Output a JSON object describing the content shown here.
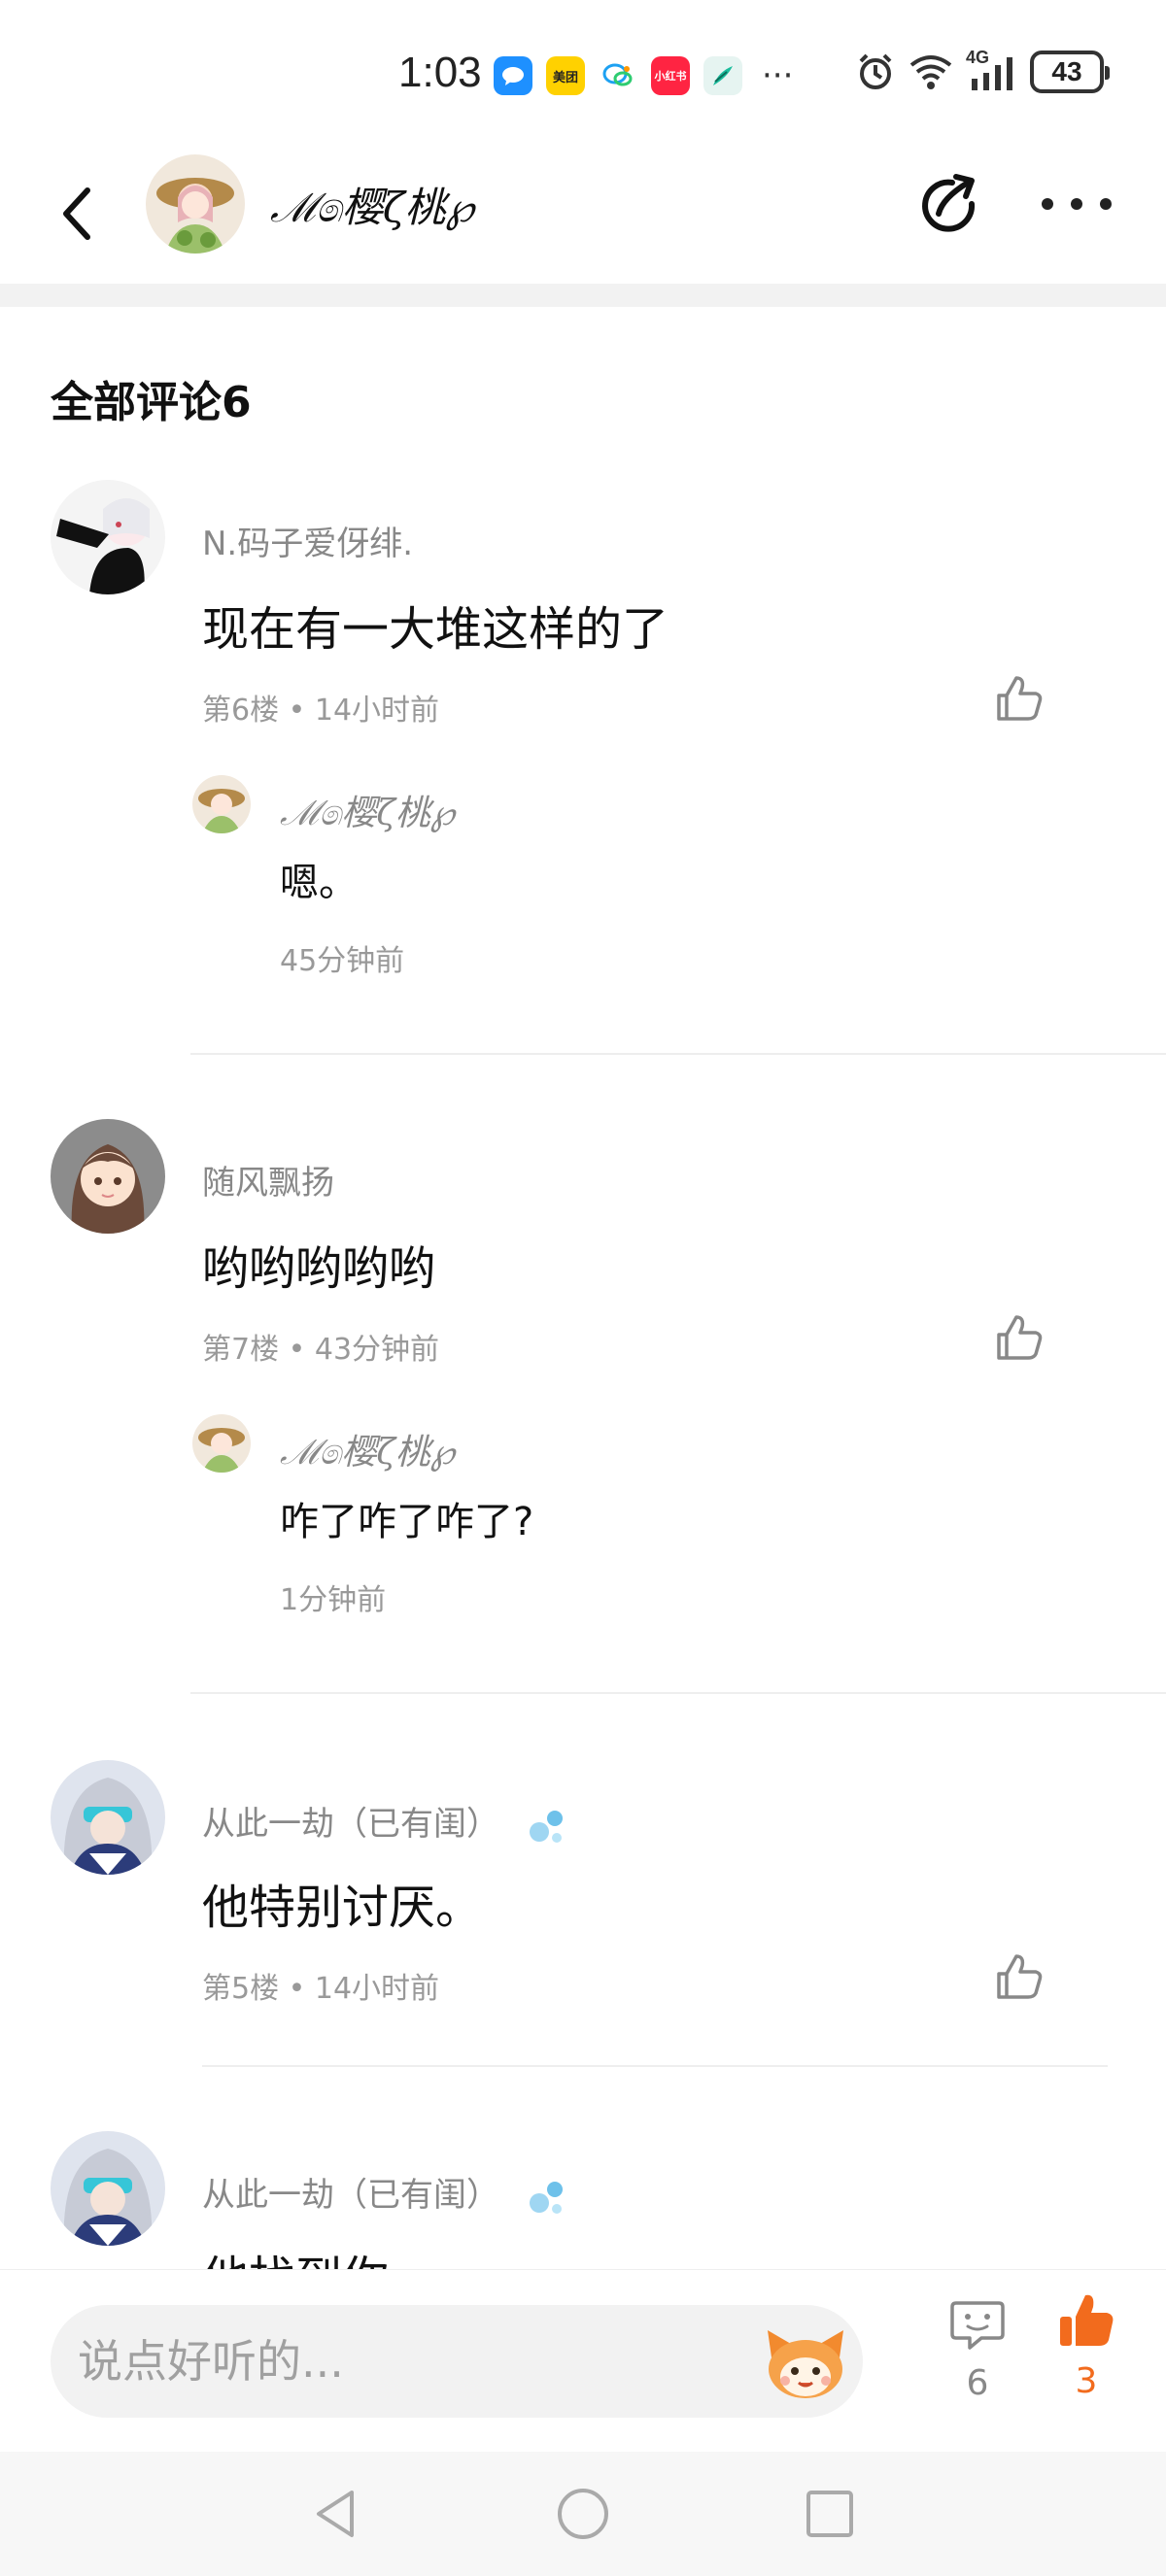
{
  "status_bar": {
    "time": "1:03",
    "apps": [
      {
        "icon": "chat-bubble-app-icon",
        "color": "#1e90ff",
        "label": ""
      },
      {
        "icon": "meituan-app-icon",
        "color": "#ffd100",
        "label": "美团"
      },
      {
        "icon": "messages-app-icon",
        "color": "#ffffff",
        "label": ""
      },
      {
        "icon": "xiaohongshu-app-icon",
        "color": "#ff2442",
        "label": "小红书"
      },
      {
        "icon": "feather-app-icon",
        "color": "#e6f4f1",
        "label": ""
      }
    ],
    "more": "···",
    "battery": "43",
    "network": "4G"
  },
  "header": {
    "title": "ℳ෧樱ζ桃℘"
  },
  "section": {
    "title": "全部评论6"
  },
  "comments": [
    {
      "user": "N.码子爱伢绯.",
      "text": "现在有一大堆这样的了",
      "meta": "第6楼 • 14小时前",
      "reply": {
        "user": "ℳ෧樱ζ桃℘",
        "text": "嗯。",
        "time": "45分钟前"
      }
    },
    {
      "user": "随风飘扬",
      "text": "哟哟哟哟哟",
      "meta": "第7楼 • 43分钟前",
      "reply": {
        "user": "ℳ෧樱ζ桃℘",
        "text": "咋了咋了咋了?",
        "time": "1分钟前"
      }
    },
    {
      "user": "从此一劫（已有闺）",
      "text": "他特别讨厌。",
      "meta": "第5楼 • 14小时前"
    },
    {
      "user": "从此一劫（已有闺）",
      "text": "他找到你"
    }
  ],
  "bottom_bar": {
    "input_placeholder": "说点好听的...",
    "comment_count": "6",
    "like_count": "3"
  },
  "colors": {
    "accent": "#f26b1d",
    "muted_text": "#999999",
    "input_bg": "#f2f2f2"
  }
}
